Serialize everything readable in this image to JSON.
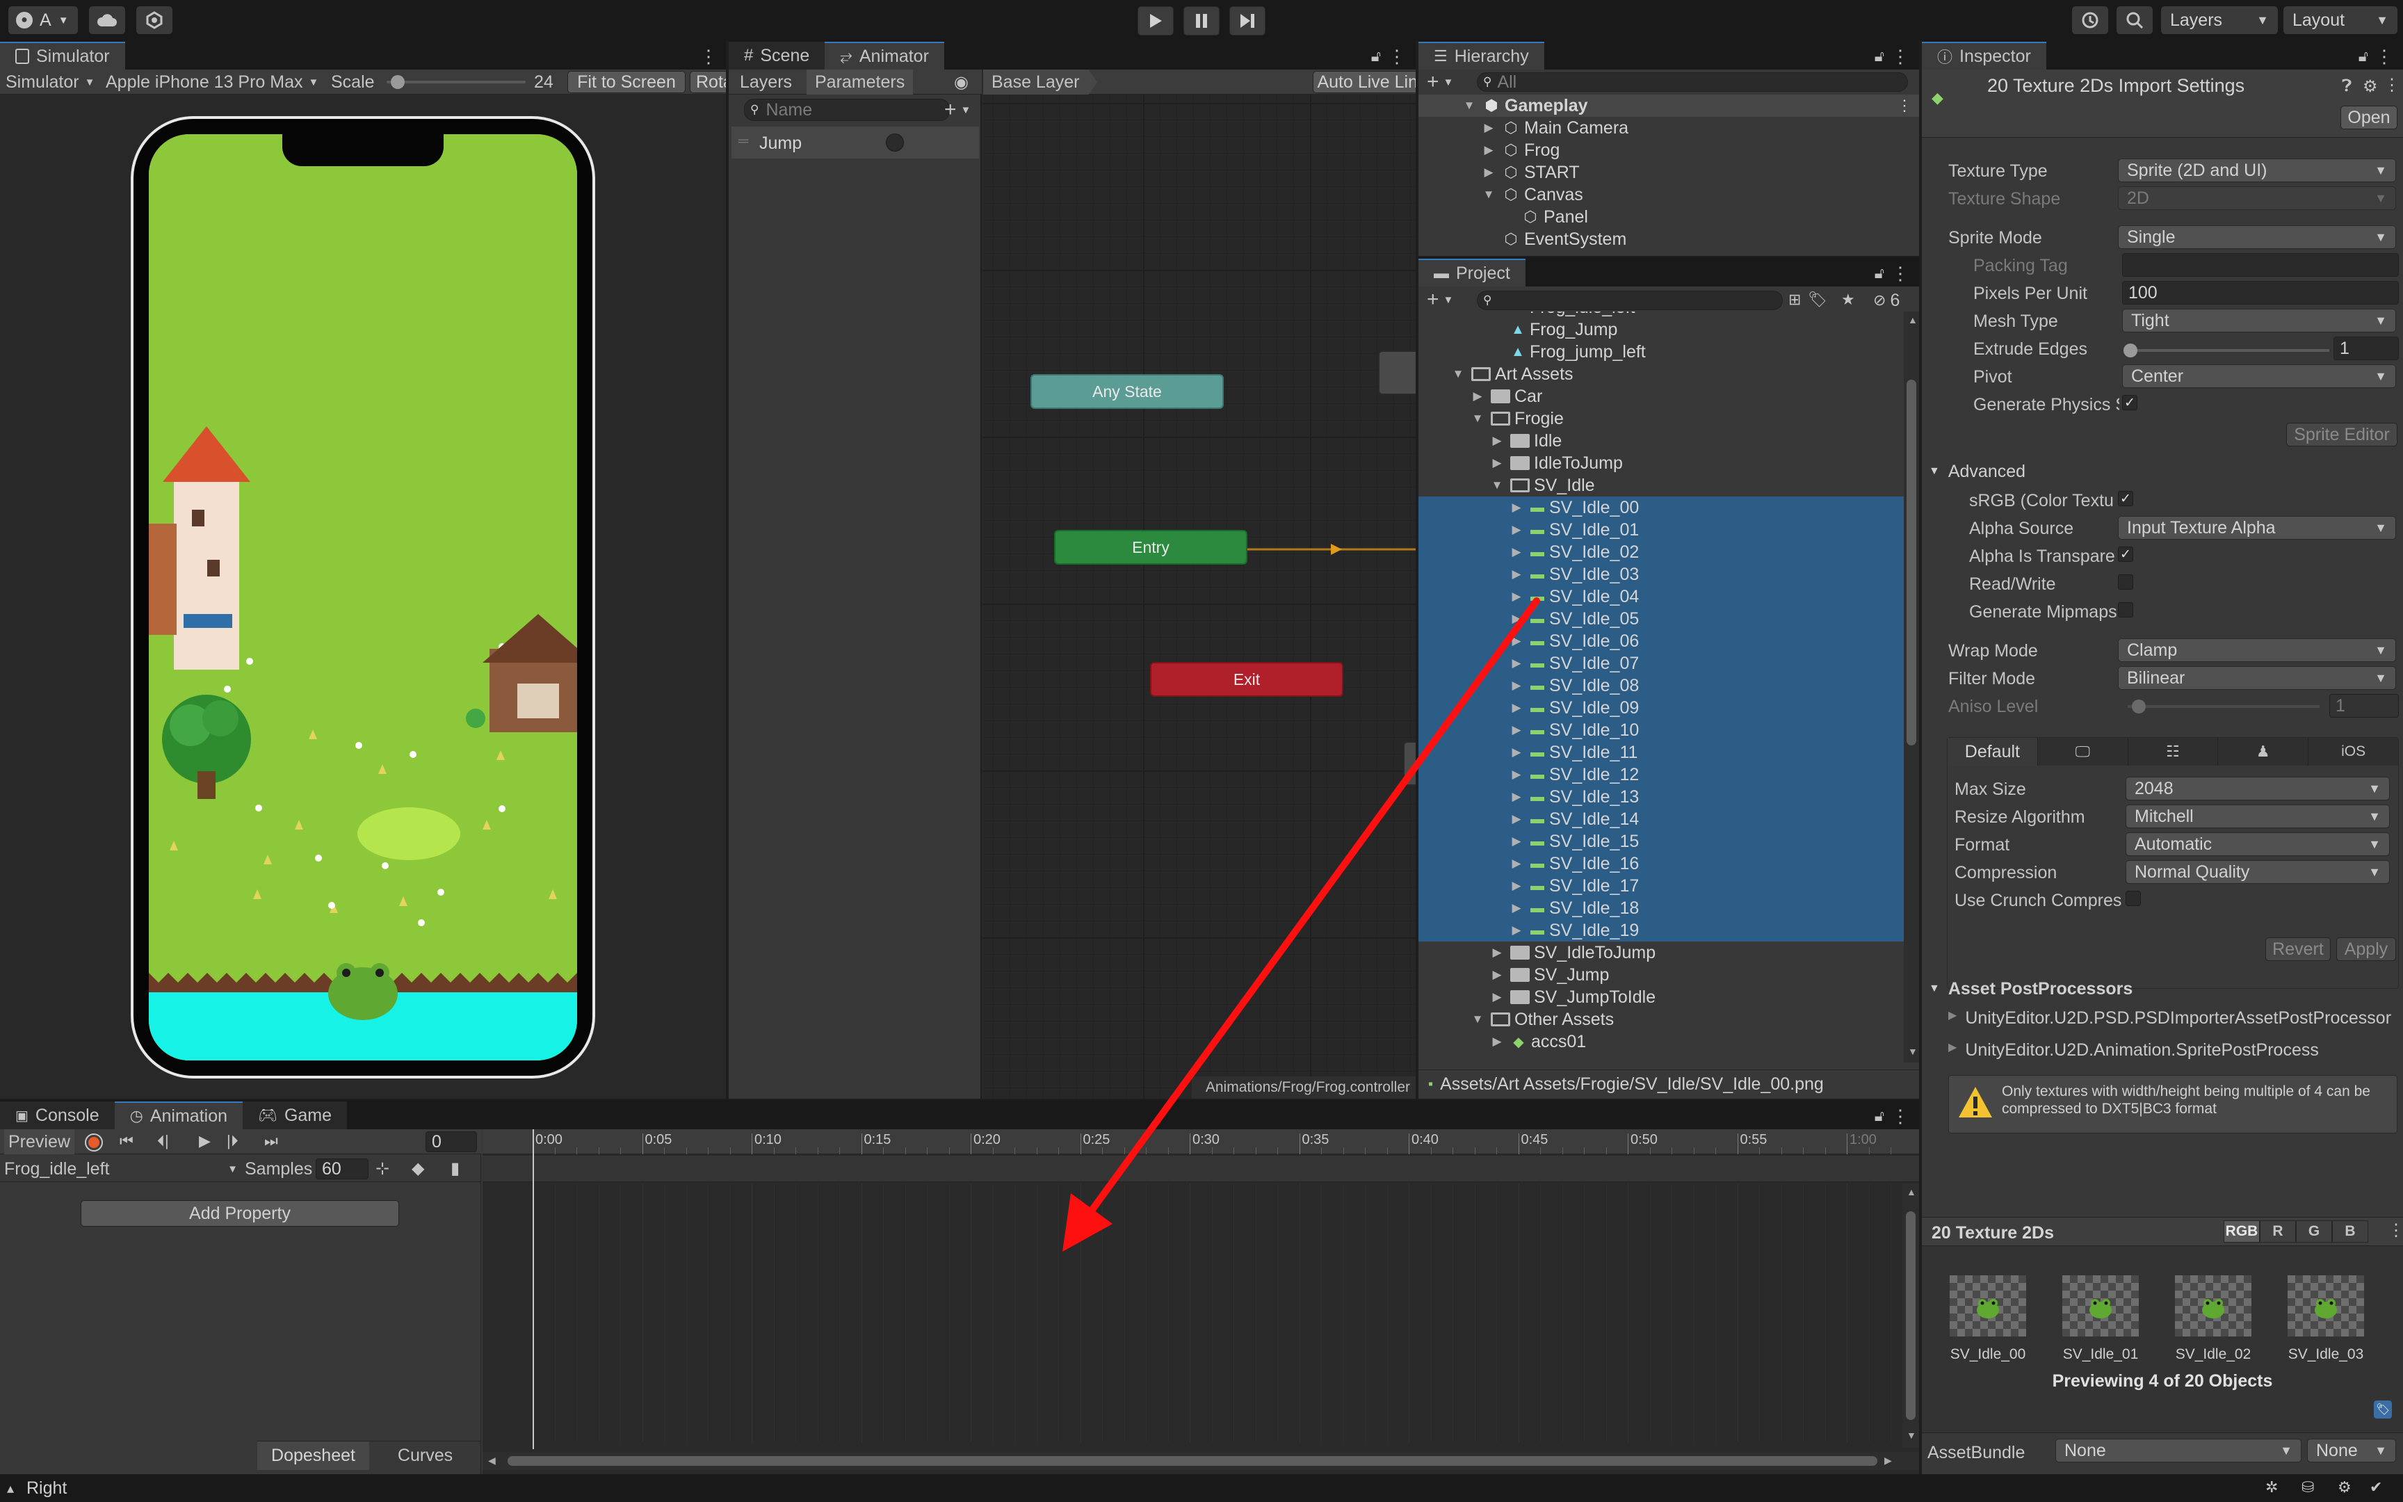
{
  "toolbar": {
    "account": "A",
    "layers": "Layers",
    "layout": "Layout"
  },
  "simulator": {
    "tab": "Simulator",
    "mode": "Simulator",
    "device": "Apple iPhone 13 Pro Max",
    "scale_label": "Scale",
    "scale_value": "24",
    "scale_fraction": 0.08,
    "fit": "Fit to Screen",
    "rotate": "Rota"
  },
  "animator": {
    "tab_scene": "Scene",
    "tab_animator": "Animator",
    "layers_tab": "Layers",
    "params_tab": "Parameters",
    "search_placeholder": "Name",
    "param_name": "Jump",
    "breadcrumb": "Base Layer",
    "auto_live": "Auto Live Link",
    "nodes": {
      "any": "Any State",
      "entry": "Entry",
      "exit": "Exit"
    },
    "path": "Animations/Frog/Frog.controller"
  },
  "hierarchy": {
    "tab": "Hierarchy",
    "search_placeholder": "All",
    "items": [
      {
        "label": "Gameplay",
        "level": 0,
        "arrow": "down",
        "bold": true,
        "icon": "unity"
      },
      {
        "label": "Main Camera",
        "level": 1,
        "arrow": "right",
        "icon": "cube"
      },
      {
        "label": "Frog",
        "level": 1,
        "arrow": "right",
        "icon": "cube"
      },
      {
        "label": "START",
        "level": 1,
        "arrow": "right",
        "icon": "cube"
      },
      {
        "label": "Canvas",
        "level": 1,
        "arrow": "down",
        "icon": "cube"
      },
      {
        "label": "Panel",
        "level": 2,
        "arrow": "",
        "icon": "cube"
      },
      {
        "label": "EventSystem",
        "level": 1,
        "arrow": "",
        "icon": "cube"
      }
    ]
  },
  "project": {
    "tab": "Project",
    "hidden_count": "6",
    "footer_path": "Assets/Art Assets/Frogie/SV_Idle/SV_Idle_00.png",
    "items": [
      {
        "label": "Frog_idle_left",
        "level": 3,
        "arrow": "",
        "icon": "anim"
      },
      {
        "label": "Frog_Jump",
        "level": 3,
        "arrow": "",
        "icon": "anim"
      },
      {
        "label": "Frog_jump_left",
        "level": 3,
        "arrow": "",
        "icon": "anim"
      },
      {
        "label": "Art Assets",
        "level": 1,
        "arrow": "down",
        "icon": "folder-open"
      },
      {
        "label": "Car",
        "level": 2,
        "arrow": "right",
        "icon": "folder"
      },
      {
        "label": "Frogie",
        "level": 2,
        "arrow": "down",
        "icon": "folder-open"
      },
      {
        "label": "Idle",
        "level": 3,
        "arrow": "right",
        "icon": "folder"
      },
      {
        "label": "IdleToJump",
        "level": 3,
        "arrow": "right",
        "icon": "folder"
      },
      {
        "label": "SV_Idle",
        "level": 3,
        "arrow": "down",
        "icon": "folder-open"
      },
      {
        "label": "SV_Idle_00",
        "level": 4,
        "arrow": "right",
        "icon": "sprite",
        "sel": true
      },
      {
        "label": "SV_Idle_01",
        "level": 4,
        "arrow": "right",
        "icon": "sprite",
        "sel": true
      },
      {
        "label": "SV_Idle_02",
        "level": 4,
        "arrow": "right",
        "icon": "sprite",
        "sel": true
      },
      {
        "label": "SV_Idle_03",
        "level": 4,
        "arrow": "right",
        "icon": "sprite",
        "sel": true
      },
      {
        "label": "SV_Idle_04",
        "level": 4,
        "arrow": "right",
        "icon": "sprite",
        "sel": true
      },
      {
        "label": "SV_Idle_05",
        "level": 4,
        "arrow": "right",
        "icon": "sprite",
        "sel": true
      },
      {
        "label": "SV_Idle_06",
        "level": 4,
        "arrow": "right",
        "icon": "sprite",
        "sel": true
      },
      {
        "label": "SV_Idle_07",
        "level": 4,
        "arrow": "right",
        "icon": "sprite",
        "sel": true
      },
      {
        "label": "SV_Idle_08",
        "level": 4,
        "arrow": "right",
        "icon": "sprite",
        "sel": true
      },
      {
        "label": "SV_Idle_09",
        "level": 4,
        "arrow": "right",
        "icon": "sprite",
        "sel": true
      },
      {
        "label": "SV_Idle_10",
        "level": 4,
        "arrow": "right",
        "icon": "sprite",
        "sel": true
      },
      {
        "label": "SV_Idle_11",
        "level": 4,
        "arrow": "right",
        "icon": "sprite",
        "sel": true
      },
      {
        "label": "SV_Idle_12",
        "level": 4,
        "arrow": "right",
        "icon": "sprite",
        "sel": true
      },
      {
        "label": "SV_Idle_13",
        "level": 4,
        "arrow": "right",
        "icon": "sprite",
        "sel": true
      },
      {
        "label": "SV_Idle_14",
        "level": 4,
        "arrow": "right",
        "icon": "sprite",
        "sel": true
      },
      {
        "label": "SV_Idle_15",
        "level": 4,
        "arrow": "right",
        "icon": "sprite",
        "sel": true
      },
      {
        "label": "SV_Idle_16",
        "level": 4,
        "arrow": "right",
        "icon": "sprite",
        "sel": true
      },
      {
        "label": "SV_Idle_17",
        "level": 4,
        "arrow": "right",
        "icon": "sprite",
        "sel": true
      },
      {
        "label": "SV_Idle_18",
        "level": 4,
        "arrow": "right",
        "icon": "sprite",
        "sel": true
      },
      {
        "label": "SV_Idle_19",
        "level": 4,
        "arrow": "right",
        "icon": "sprite",
        "sel": true
      },
      {
        "label": "SV_IdleToJump",
        "level": 3,
        "arrow": "right",
        "icon": "folder"
      },
      {
        "label": "SV_Jump",
        "level": 3,
        "arrow": "right",
        "icon": "folder"
      },
      {
        "label": "SV_JumpToIdle",
        "level": 3,
        "arrow": "right",
        "icon": "folder"
      },
      {
        "label": "Other Assets",
        "level": 2,
        "arrow": "down",
        "icon": "folder-open"
      },
      {
        "label": "accs01",
        "level": 3,
        "arrow": "right",
        "icon": "prefab"
      }
    ]
  },
  "inspector": {
    "tab": "Inspector",
    "title": "20 Texture 2Ds Import Settings",
    "open": "Open",
    "texture_type_label": "Texture Type",
    "texture_type": "Sprite (2D and UI)",
    "texture_shape_label": "Texture Shape",
    "texture_shape": "2D",
    "sprite_mode_label": "Sprite Mode",
    "sprite_mode": "Single",
    "packing_tag_label": "Packing Tag",
    "packing_tag": "",
    "ppu_label": "Pixels Per Unit",
    "ppu": "100",
    "mesh_type_label": "Mesh Type",
    "mesh_type": "Tight",
    "extrude_label": "Extrude Edges",
    "extrude": "1",
    "pivot_label": "Pivot",
    "pivot": "Center",
    "gen_physics_label": "Generate Physics S",
    "sprite_editor": "Sprite Editor",
    "advanced": "Advanced",
    "srgb_label": "sRGB (Color Textu",
    "alpha_source_label": "Alpha Source",
    "alpha_source": "Input Texture Alpha",
    "alpha_transparency_label": "Alpha Is Transpare",
    "read_write_label": "Read/Write",
    "gen_mipmaps_label": "Generate Mipmaps",
    "wrap_label": "Wrap Mode",
    "wrap": "Clamp",
    "filter_label": "Filter Mode",
    "filter": "Bilinear",
    "aniso_label": "Aniso Level",
    "aniso": "1",
    "platform_default": "Default",
    "platform_ios": "iOS",
    "max_size_label": "Max Size",
    "max_size": "2048",
    "resize_label": "Resize Algorithm",
    "resize": "Mitchell",
    "format_label": "Format",
    "format": "Automatic",
    "compression_label": "Compression",
    "compression": "Normal Quality",
    "crunch_label": "Use Crunch Compres",
    "revert": "Revert",
    "apply": "Apply",
    "postproc_header": "Asset PostProcessors",
    "postproc": [
      "UnityEditor.U2D.PSD.PSDImporterAssetPostProcessor",
      "UnityEditor.U2D.Animation.SpritePostProcess"
    ],
    "warning": "Only textures with width/height being multiple of 4 can be compressed to DXT5|BC3 format",
    "preview_title": "20 Texture 2Ds",
    "channels": [
      "RGB",
      "R",
      "G",
      "B"
    ],
    "previews": [
      "SV_Idle_00",
      "SV_Idle_01",
      "SV_Idle_02",
      "SV_Idle_03"
    ],
    "previewing": "Previewing 4 of 20 Objects",
    "assetbundle_label": "AssetBundle",
    "assetbundle": "None",
    "assetbundle_variant": "None"
  },
  "bottom": {
    "tab_console": "Console",
    "tab_animation": "Animation",
    "tab_game": "Game",
    "preview": "Preview",
    "frame": "0",
    "clip": "Frog_idle_left",
    "samples_label": "Samples",
    "samples": "60",
    "add_property": "Add Property",
    "dopesheet": "Dopesheet",
    "curves": "Curves",
    "ticks": [
      "0:00",
      "0:05",
      "0:10",
      "0:15",
      "0:20",
      "0:25",
      "0:30",
      "0:35",
      "0:40",
      "0:45",
      "0:50",
      "0:55",
      "1:00"
    ]
  },
  "status": {
    "text": "Right"
  },
  "colors": {
    "selection": "#2c5d87",
    "any_state": "#5b9c95",
    "entry": "#2b8a3e",
    "exit": "#b0202a",
    "annotation_arrow": "#ff1010"
  }
}
